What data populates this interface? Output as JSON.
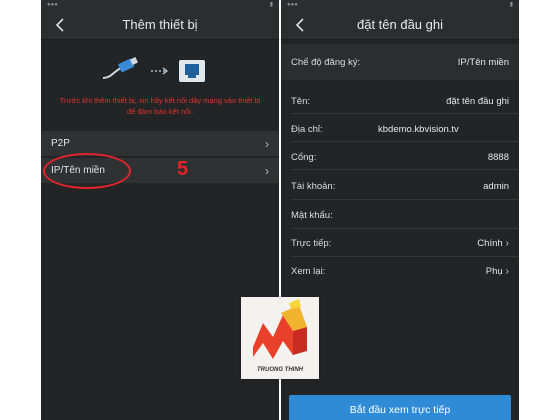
{
  "colors": {
    "screen_bg": "#222426",
    "row_bg": "#2f3133",
    "annotation_red": "#e3232b",
    "primary_blue": "#2f8bd6"
  },
  "left": {
    "title": "Thêm thiết bị",
    "notice": "Trước khi thêm thiết bị, xin hãy kết nối dây mạng vào thiết bị để đảm bảo kết nối.",
    "items": [
      {
        "label": "P2P",
        "icon": "chevron-right-icon"
      },
      {
        "label": "IP/Tên miền",
        "icon": "chevron-right-icon"
      }
    ],
    "annotation_number": "5"
  },
  "right": {
    "title": "đặt tên đầu ghi",
    "fields": {
      "mode": {
        "label": "Chế độ đăng ký:",
        "value": "IP/Tên miền"
      },
      "name": {
        "label": "Tên:",
        "value": "đặt tên đầu ghi"
      },
      "address": {
        "label": "Địa chỉ:",
        "value": "kbdemo.kbvision.tv"
      },
      "port": {
        "label": "Cổng:",
        "value": "8888"
      },
      "account": {
        "label": "Tài khoản:",
        "value": "admin"
      },
      "password": {
        "label": "Mật khẩu:",
        "value": ""
      },
      "live": {
        "label": "Trực tiếp:",
        "value": "Chính"
      },
      "playback": {
        "label": "Xem lại:",
        "value": "Phụ"
      }
    },
    "start_button": "Bắt đầu xem trực tiếp"
  },
  "watermark": {
    "text": "TRUONG THINH"
  }
}
